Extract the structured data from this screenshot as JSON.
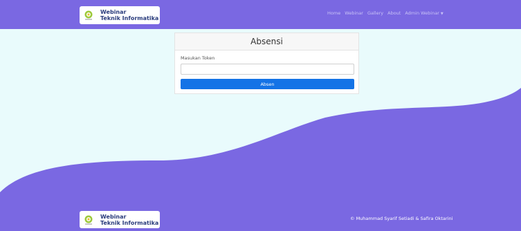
{
  "colors": {
    "primary": "#7a68e2",
    "background": "#e9fbfc",
    "button": "#1473e6",
    "brand_text": "#2a3c7c"
  },
  "navbar": {
    "brand_line1": "Webinar",
    "brand_line2": "Teknik Informatika",
    "links": [
      "Home",
      "Webinar",
      "Gallery",
      "About"
    ],
    "dropdown_label": "Admin Webinar",
    "dropdown_icon": "caret-down-icon"
  },
  "card": {
    "title": "Absensi",
    "token_label": "Masukan Token",
    "token_value": "",
    "submit_label": "Absen"
  },
  "footer": {
    "brand_line1": "Webinar",
    "brand_line2": "Teknik Informatika",
    "copyright_icon": "copyright-icon",
    "copyright_text": "Muhammad Syarif Setiadi & Safira Oktarini"
  }
}
